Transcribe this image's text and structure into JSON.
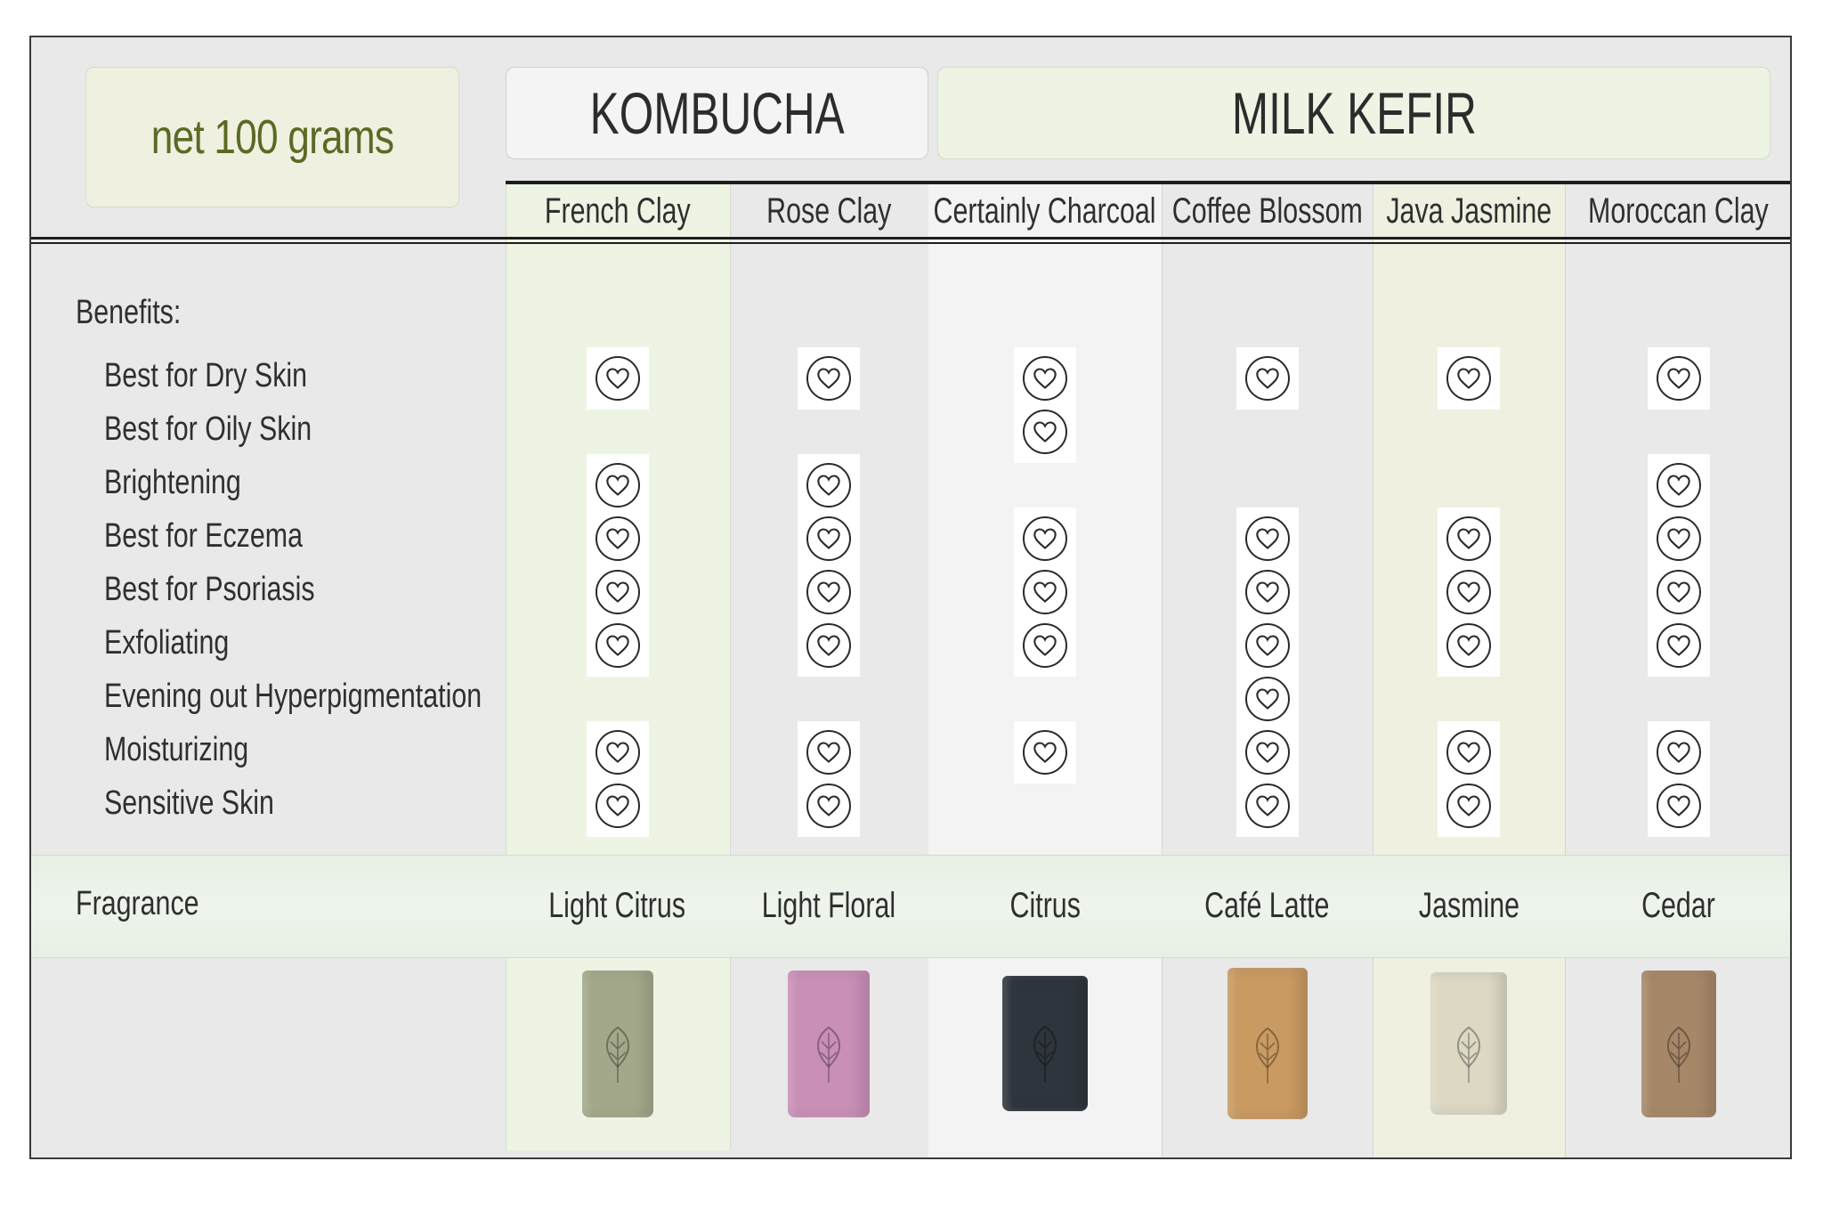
{
  "net_label": "net 100 grams",
  "groups": {
    "kombucha": "KOMBUCHA",
    "milk_kefir": "MILK KEFIR"
  },
  "products": [
    {
      "name": "French Clay",
      "fragrance": "Light Citrus",
      "soap_color": "#a3a88a"
    },
    {
      "name": "Rose Clay",
      "fragrance": "Light Floral",
      "soap_color": "#c98fb7"
    },
    {
      "name": "Certainly Charcoal",
      "fragrance": "Citrus",
      "soap_color": "#2f353d"
    },
    {
      "name": "Coffee Blossom",
      "fragrance": "Café Latte",
      "soap_color": "#c99a62"
    },
    {
      "name": "Java Jasmine",
      "fragrance": "Jasmine",
      "soap_color": "#dcd8c4"
    },
    {
      "name": "Moroccan Clay",
      "fragrance": "Cedar",
      "soap_color": "#a68768"
    }
  ],
  "benefits_heading": "Benefits:",
  "benefits": [
    "Best for Dry Skin",
    "Best for Oily Skin",
    "Brightening",
    "Best for Eczema",
    "Best for Psoriasis",
    "Exfoliating",
    "Evening out Hyperpigmentation",
    "Moisturizing",
    "Sensitive Skin"
  ],
  "benefit_matrix": [
    [
      true,
      false,
      true,
      true,
      true,
      true,
      false,
      true,
      true
    ],
    [
      true,
      false,
      true,
      true,
      true,
      true,
      false,
      true,
      true
    ],
    [
      true,
      true,
      false,
      true,
      true,
      true,
      false,
      true,
      false
    ],
    [
      true,
      false,
      false,
      true,
      true,
      true,
      true,
      true,
      true
    ],
    [
      true,
      false,
      false,
      true,
      true,
      true,
      false,
      true,
      true
    ],
    [
      true,
      false,
      true,
      true,
      true,
      true,
      false,
      true,
      true
    ]
  ],
  "fragrance_label": "Fragrance",
  "colors": {
    "french_clay_column": "#eef4e4",
    "charcoal_column": "#f3f3f3",
    "jasmine_column": "#eff0e0",
    "net_label_text": "#5a6a24"
  },
  "icons": {
    "benefit_marker": "heart-in-circle-icon"
  }
}
